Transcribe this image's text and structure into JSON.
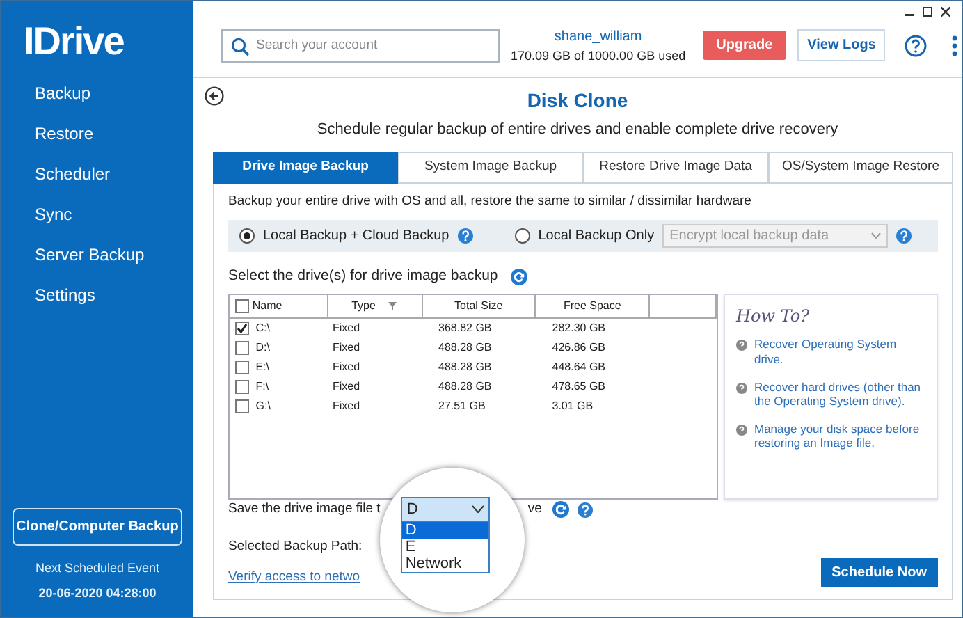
{
  "sidebar": {
    "logo": "IDrive",
    "items": [
      {
        "label": "Backup"
      },
      {
        "label": "Restore"
      },
      {
        "label": "Scheduler"
      },
      {
        "label": "Sync"
      },
      {
        "label": "Server Backup"
      },
      {
        "label": "Settings"
      }
    ],
    "clone_button": "Clone/Computer Backup",
    "next_event_label": "Next Scheduled Event",
    "next_event_time": "20-06-2020 04:28:00"
  },
  "header": {
    "search": {
      "placeholder": "Search your account"
    },
    "username": "shane_william",
    "usage": "170.09 GB of 1000.00 GB used",
    "buttons": [
      "Upgrade",
      "View Logs"
    ]
  },
  "page": {
    "title": "Disk Clone",
    "subtitle": "Schedule regular backup of entire drives and enable complete drive recovery"
  },
  "tabs": [
    {
      "label": "Drive Image Backup",
      "selected": true
    },
    {
      "label": "System Image Backup",
      "selected": false
    },
    {
      "label": "Restore Drive Image Data",
      "selected": false
    },
    {
      "label": "OS/System Image Restore",
      "selected": false
    }
  ],
  "description": "Backup your entire drive with OS and all, restore the same to similar / dissimilar hardware",
  "backup_modes": [
    {
      "label": "Local Backup + Cloud Backup",
      "selected": true
    },
    {
      "label": "Local Backup Only",
      "selected": false
    }
  ],
  "encrypt_select": {
    "value": "Encrypt local backup data",
    "disabled": true
  },
  "drives_label": "Select the drive(s) for drive image backup",
  "table": {
    "columns": [
      "Name",
      "Type",
      "Total Size",
      "Free Space"
    ],
    "all_checked": false,
    "rows": [
      {
        "name": "C:\\",
        "type": "Fixed",
        "total": "368.82 GB",
        "free": "282.30 GB",
        "checked": true
      },
      {
        "name": "D:\\",
        "type": "Fixed",
        "total": "488.28 GB",
        "free": "426.86 GB",
        "checked": false
      },
      {
        "name": "E:\\",
        "type": "Fixed",
        "total": "488.28 GB",
        "free": "448.64 GB",
        "checked": false
      },
      {
        "name": "F:\\",
        "type": "Fixed",
        "total": "488.28 GB",
        "free": "478.65 GB",
        "checked": false
      },
      {
        "name": "G:\\",
        "type": "Fixed",
        "total": "27.51 GB",
        "free": "3.01 GB",
        "checked": false
      }
    ]
  },
  "how_to": {
    "title": "How To?",
    "links": [
      "Recover Operating System drive.",
      "Recover hard drives (other than the Operating System drive).",
      "Manage your disk space before restoring an Image file."
    ]
  },
  "save_label_start": "Save the drive image file t",
  "save_label_end": "ve",
  "selected_path_label": "Selected Backup Path:",
  "verify_link": "Verify access to netwo",
  "dropdown": {
    "value": "D",
    "options": [
      {
        "label": "D",
        "selected": true
      },
      {
        "label": "E",
        "selected": false
      },
      {
        "label": "Network",
        "selected": false
      }
    ]
  },
  "schedule_button": "Schedule Now"
}
